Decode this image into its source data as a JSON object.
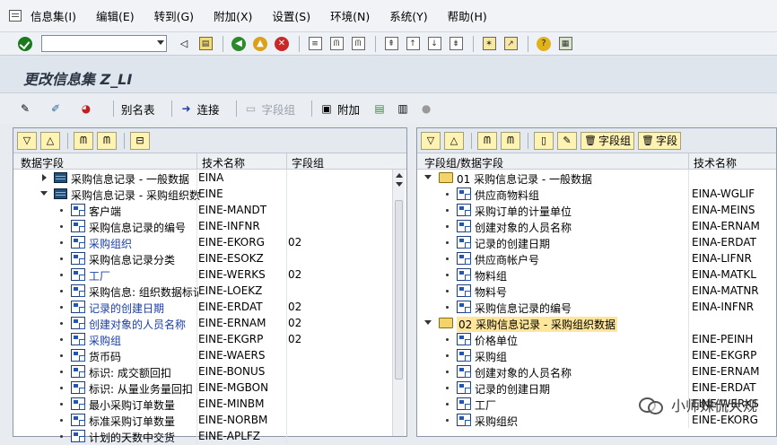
{
  "menu": {
    "items": [
      "信息集(I)",
      "编辑(E)",
      "转到(G)",
      "附加(X)",
      "设置(S)",
      "环境(N)",
      "系统(Y)",
      "帮助(H)"
    ]
  },
  "std_toolbar": {
    "command_field": ""
  },
  "title": "更改信息集 Z_LI",
  "app_toolbar": {
    "alias": "别名表",
    "join": "连接",
    "field_group": "字段组",
    "extras": "附加"
  },
  "left_panel": {
    "headers": {
      "data_field": "数据字段",
      "tech_name": "技术名称",
      "field_group": "字段组"
    },
    "rows": [
      {
        "kind": "table",
        "expanded": false,
        "label": "采购信息记录 - 一般数据",
        "tech": "EINA",
        "group": ""
      },
      {
        "kind": "table",
        "expanded": true,
        "label": "采购信息记录 - 采购组织数",
        "tech": "EINE",
        "group": ""
      },
      {
        "kind": "field",
        "label": "客户端",
        "tech": "EINE-MANDT",
        "group": "",
        "blue": false
      },
      {
        "kind": "field",
        "label": "采购信息记录的编号",
        "tech": "EINE-INFNR",
        "group": "",
        "blue": false
      },
      {
        "kind": "field",
        "label": "采购组织",
        "tech": "EINE-EKORG",
        "group": "02",
        "blue": true
      },
      {
        "kind": "field",
        "label": "采购信息记录分类",
        "tech": "EINE-ESOKZ",
        "group": "",
        "blue": false
      },
      {
        "kind": "field",
        "label": "工厂",
        "tech": "EINE-WERKS",
        "group": "02",
        "blue": true
      },
      {
        "kind": "field",
        "label": "采购信息: 组织数据标记",
        "tech": "EINE-LOEKZ",
        "group": "",
        "blue": false
      },
      {
        "kind": "field",
        "label": "记录的创建日期",
        "tech": "EINE-ERDAT",
        "group": "02",
        "blue": true
      },
      {
        "kind": "field",
        "label": "创建对象的人员名称",
        "tech": "EINE-ERNAM",
        "group": "02",
        "blue": true
      },
      {
        "kind": "field",
        "label": "采购组",
        "tech": "EINE-EKGRP",
        "group": "02",
        "blue": true
      },
      {
        "kind": "field",
        "label": "货币码",
        "tech": "EINE-WAERS",
        "group": "",
        "blue": false
      },
      {
        "kind": "field",
        "label": "标识: 成交额回扣",
        "tech": "EINE-BONUS",
        "group": "",
        "blue": false
      },
      {
        "kind": "field",
        "label": "标识: 从量业务量回扣",
        "tech": "EINE-MGBON",
        "group": "",
        "blue": false
      },
      {
        "kind": "field",
        "label": "最小采购订单数量",
        "tech": "EINE-MINBM",
        "group": "",
        "blue": false
      },
      {
        "kind": "field",
        "label": "标准采购订单数量",
        "tech": "EINE-NORBM",
        "group": "",
        "blue": false
      },
      {
        "kind": "field",
        "label": "计划的天数中交货",
        "tech": "EINE-APLFZ",
        "group": "",
        "blue": false
      }
    ]
  },
  "right_panel": {
    "buttons": {
      "field_group": "字段组",
      "field": "字段"
    },
    "headers": {
      "group_field": "字段组/数据字段",
      "tech_name": "技术名称"
    },
    "rows": [
      {
        "kind": "folder",
        "label": "01 采购信息记录 - 一般数据",
        "tech": "",
        "highlight": false
      },
      {
        "kind": "field",
        "label": "供应商物料组",
        "tech": "EINA-WGLIF"
      },
      {
        "kind": "field",
        "label": "采购订单的计量单位",
        "tech": "EINA-MEINS"
      },
      {
        "kind": "field",
        "label": "创建对象的人员名称",
        "tech": "EINA-ERNAM"
      },
      {
        "kind": "field",
        "label": "记录的创建日期",
        "tech": "EINA-ERDAT"
      },
      {
        "kind": "field",
        "label": "供应商帐户号",
        "tech": "EINA-LIFNR"
      },
      {
        "kind": "field",
        "label": "物料组",
        "tech": "EINA-MATKL"
      },
      {
        "kind": "field",
        "label": "物料号",
        "tech": "EINA-MATNR"
      },
      {
        "kind": "field",
        "label": "采购信息记录的编号",
        "tech": "EINA-INFNR"
      },
      {
        "kind": "folder",
        "label": "02 采购信息记录 - 采购组织数据",
        "tech": "",
        "highlight": true
      },
      {
        "kind": "field",
        "label": "价格单位",
        "tech": "EINE-PEINH"
      },
      {
        "kind": "field",
        "label": "采购组",
        "tech": "EINE-EKGRP"
      },
      {
        "kind": "field",
        "label": "创建对象的人员名称",
        "tech": "EINE-ERNAM"
      },
      {
        "kind": "field",
        "label": "记录的创建日期",
        "tech": "EINE-ERDAT"
      },
      {
        "kind": "field",
        "label": "工厂",
        "tech": "EINE-WERKS"
      },
      {
        "kind": "field",
        "label": "采购组织",
        "tech": "EINE-EKORG"
      }
    ]
  },
  "watermark": "小师妹侃大规"
}
